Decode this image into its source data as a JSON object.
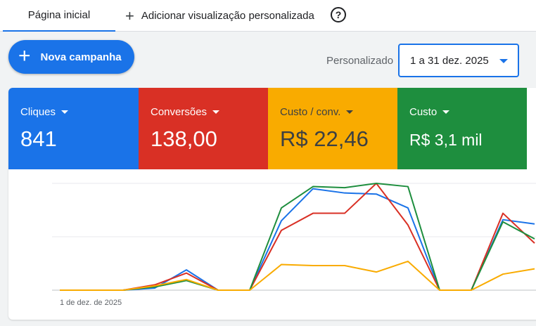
{
  "tabs": {
    "home": "Página inicial",
    "add_custom": "Adicionar visualização personalizada",
    "help_glyph": "?"
  },
  "toolbar": {
    "new_campaign": "Nova campanha",
    "period_label": "Personalizado",
    "date_range": "1 a 31 dez. 2025"
  },
  "metrics": [
    {
      "label": "Cliques",
      "value": "841",
      "color": "#1a73e8"
    },
    {
      "label": "Conversões",
      "value": "138,00",
      "color": "#d93025"
    },
    {
      "label": "Custo / conv.",
      "value": "R$ 22,46",
      "color": "#f9ab00"
    },
    {
      "label": "Custo",
      "value": "R$ 3,1 mil",
      "color": "#1e8e3e"
    }
  ],
  "chart_data": {
    "type": "line",
    "x_label_first": "1 de dez. de 2025",
    "x": [
      1,
      2,
      3,
      4,
      5,
      6,
      7,
      8,
      9,
      10,
      11,
      12,
      13,
      14,
      15,
      16,
      17,
      18,
      19,
      20,
      21,
      22,
      23,
      24
    ],
    "ylim": [
      0,
      100
    ],
    "grid": true,
    "series": [
      {
        "color": "#1a73e8",
        "values": [
          0,
          0,
          0,
          2,
          19,
          0,
          0,
          65,
          95,
          91,
          90,
          77,
          0,
          0,
          66,
          62
        ]
      },
      {
        "color": "#d93025",
        "values": [
          0,
          0,
          0,
          5,
          16,
          0,
          0,
          56,
          72,
          72,
          100,
          61,
          0,
          0,
          72,
          44
        ]
      },
      {
        "color": "#1e8e3e",
        "values": [
          0,
          0,
          0,
          3,
          9,
          0,
          0,
          77,
          97,
          96,
          100,
          97,
          0,
          0,
          64,
          48
        ]
      },
      {
        "color": "#f9ab00",
        "values": [
          0,
          0,
          0,
          4,
          10,
          0,
          0,
          24,
          23,
          23,
          17,
          27,
          0,
          0,
          15,
          20
        ]
      }
    ]
  }
}
